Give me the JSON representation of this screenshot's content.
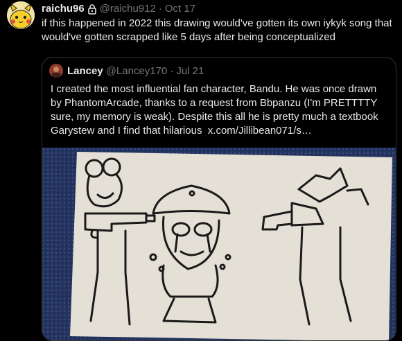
{
  "tweet": {
    "author_name": "raichu96",
    "handle": "@raichu912",
    "separator": "·",
    "date": "Oct 17",
    "text": "if this happened in 2022 this drawing would've gotten its own iykyk song that would've gotten scrapped like 5 days after being conceptualized"
  },
  "quoted": {
    "author_name": "Lancey",
    "handle": "@Lancey170",
    "separator": "·",
    "date": "Jul 21",
    "text": "I created the most influential fan character, Bandu. He was once drawn by PhantomArcade, thanks to a request from Bbpanzu (I'm PRETTTTY sure, my memory is weak). Despite this all he is pretty much a textbook Garystew and I find that hilarious",
    "link": "x.com/Jillibean071/s…"
  },
  "icons": {
    "lock": "lock-icon",
    "avatar": "pikachu-avatar",
    "quoted_avatar": "user-avatar"
  },
  "colors": {
    "background": "#000000",
    "text": "#e7e9ea",
    "muted": "#71767b",
    "border": "#2f3336"
  }
}
